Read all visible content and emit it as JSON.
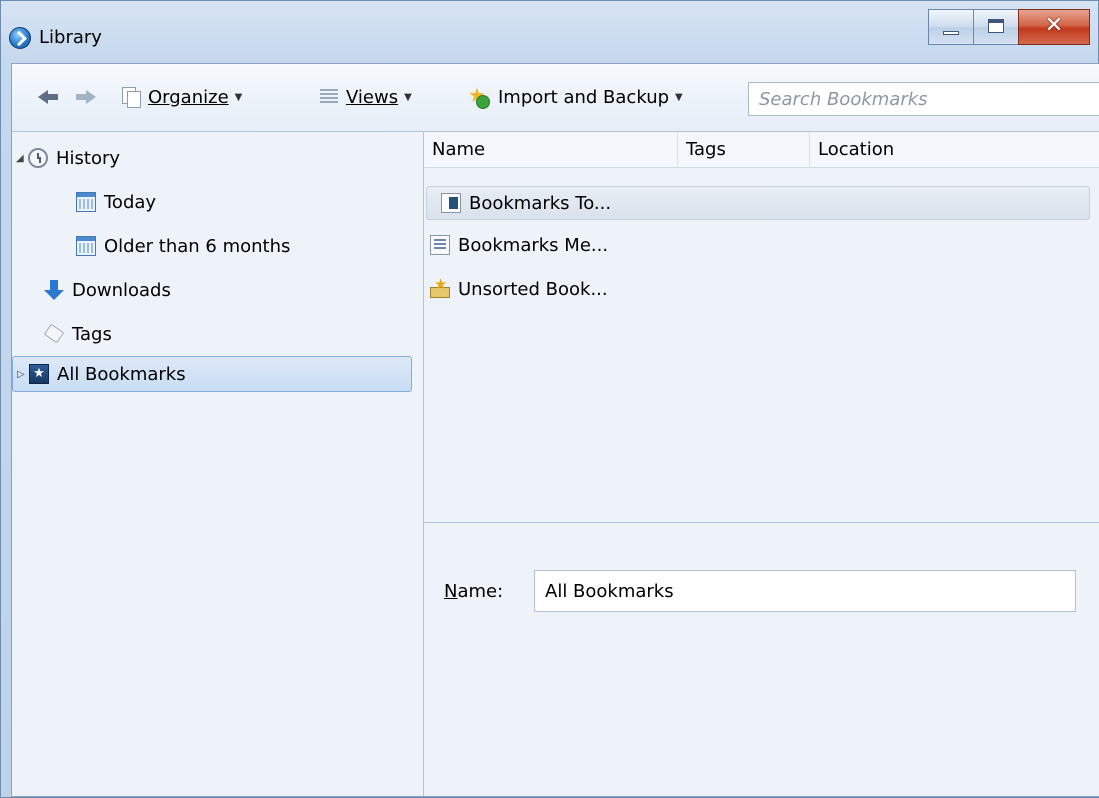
{
  "window": {
    "title": "Library"
  },
  "toolbar": {
    "organize_label": "Organize",
    "views_label": "Views",
    "import_label": "Import and Backup",
    "search_placeholder": "Search Bookmarks"
  },
  "sidebar": {
    "items": [
      {
        "label": "History"
      },
      {
        "label": "Today"
      },
      {
        "label": "Older than 6 months"
      },
      {
        "label": "Downloads"
      },
      {
        "label": "Tags"
      },
      {
        "label": "All Bookmarks"
      }
    ]
  },
  "columns": {
    "name": "Name",
    "tags": "Tags",
    "location": "Location"
  },
  "rows": [
    {
      "name": "Bookmarks To...",
      "tags": "",
      "location": ""
    },
    {
      "name": "Bookmarks Me...",
      "tags": "",
      "location": ""
    },
    {
      "name": "Unsorted Book...",
      "tags": "",
      "location": ""
    }
  ],
  "details": {
    "name_label": "Name:",
    "name_value": "All Bookmarks"
  }
}
